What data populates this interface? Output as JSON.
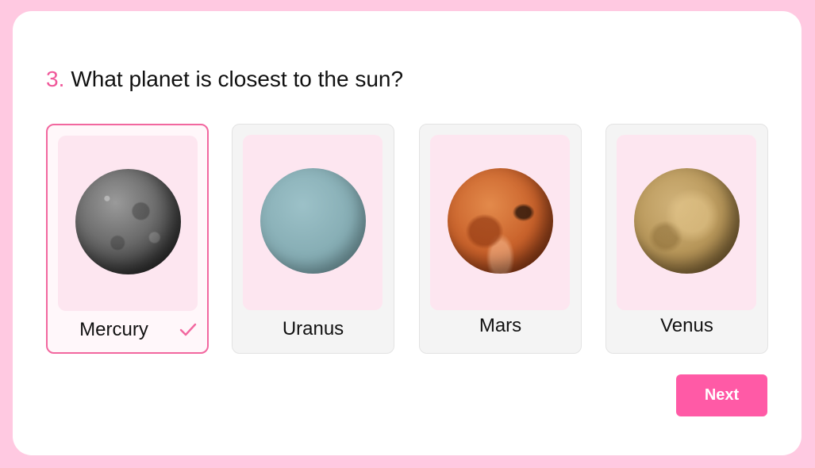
{
  "question": {
    "number": "3.",
    "text": "What planet is closest to the sun?"
  },
  "options": [
    {
      "label": "Mercury",
      "selected": true,
      "icon": "mercury-image"
    },
    {
      "label": "Uranus",
      "selected": false,
      "icon": "uranus-image"
    },
    {
      "label": "Mars",
      "selected": false,
      "icon": "mars-image"
    },
    {
      "label": "Venus",
      "selected": false,
      "icon": "venus-image"
    }
  ],
  "next_button": {
    "label": "Next"
  },
  "colors": {
    "page_background": "#ffc9e1",
    "accent": "#ff5aa6",
    "selected_border": "#f2679f",
    "thumb_background": "#fde6f0"
  }
}
